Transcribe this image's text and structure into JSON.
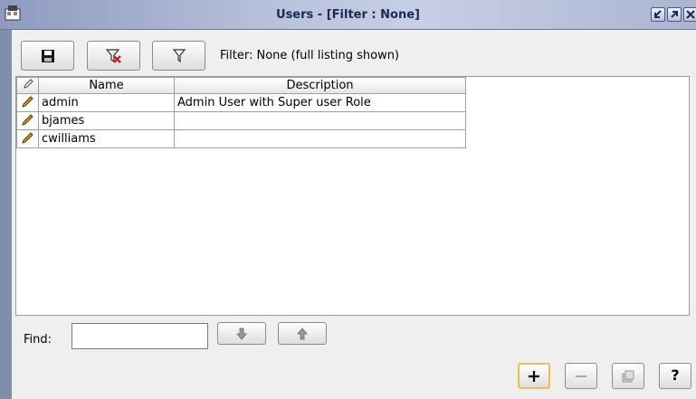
{
  "window": {
    "title": "Users - [Filter : None]"
  },
  "toolbar": {
    "filter_status": "Filter: None (full listing shown)"
  },
  "table": {
    "columns": [
      "Name",
      "Description"
    ],
    "rows": [
      {
        "name": "admin",
        "description": "Admin User with Super user Role"
      },
      {
        "name": "bjames",
        "description": ""
      },
      {
        "name": "cwilliams",
        "description": ""
      }
    ]
  },
  "find": {
    "label": "Find:",
    "value": ""
  },
  "actions": {
    "help_label": "?"
  },
  "icons": {
    "app": "app-icon",
    "save": "floppy-disk-icon",
    "clear_filter": "filter-remove-icon",
    "filter": "filter-funnel-icon",
    "edit": "pencil-icon",
    "find_next": "arrow-down-icon",
    "find_prev": "arrow-up-icon",
    "add": "plus-icon",
    "remove": "minus-icon",
    "properties": "properties-icon",
    "minimize": "minimize-icon",
    "maximize": "maximize-icon",
    "close": "close-icon"
  },
  "colors": {
    "titlebar": "#b8c2dc",
    "title_text": "#1a2a50",
    "add_highlight": "#e8c04a",
    "pencil": "#d89a20",
    "clear_x": "#cc1111"
  }
}
